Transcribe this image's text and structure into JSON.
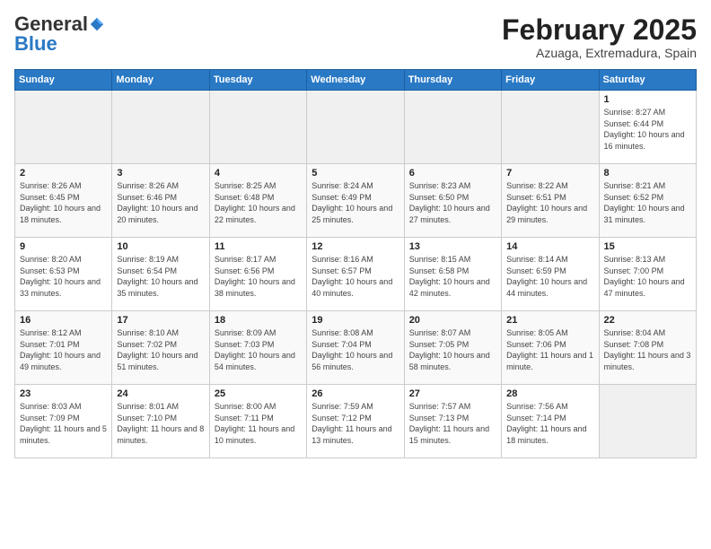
{
  "logo": {
    "general": "General",
    "blue": "Blue"
  },
  "title": {
    "month": "February 2025",
    "location": "Azuaga, Extremadura, Spain"
  },
  "headers": [
    "Sunday",
    "Monday",
    "Tuesday",
    "Wednesday",
    "Thursday",
    "Friday",
    "Saturday"
  ],
  "weeks": [
    [
      {
        "day": "",
        "info": ""
      },
      {
        "day": "",
        "info": ""
      },
      {
        "day": "",
        "info": ""
      },
      {
        "day": "",
        "info": ""
      },
      {
        "day": "",
        "info": ""
      },
      {
        "day": "",
        "info": ""
      },
      {
        "day": "1",
        "info": "Sunrise: 8:27 AM\nSunset: 6:44 PM\nDaylight: 10 hours and 16 minutes."
      }
    ],
    [
      {
        "day": "2",
        "info": "Sunrise: 8:26 AM\nSunset: 6:45 PM\nDaylight: 10 hours and 18 minutes."
      },
      {
        "day": "3",
        "info": "Sunrise: 8:26 AM\nSunset: 6:46 PM\nDaylight: 10 hours and 20 minutes."
      },
      {
        "day": "4",
        "info": "Sunrise: 8:25 AM\nSunset: 6:48 PM\nDaylight: 10 hours and 22 minutes."
      },
      {
        "day": "5",
        "info": "Sunrise: 8:24 AM\nSunset: 6:49 PM\nDaylight: 10 hours and 25 minutes."
      },
      {
        "day": "6",
        "info": "Sunrise: 8:23 AM\nSunset: 6:50 PM\nDaylight: 10 hours and 27 minutes."
      },
      {
        "day": "7",
        "info": "Sunrise: 8:22 AM\nSunset: 6:51 PM\nDaylight: 10 hours and 29 minutes."
      },
      {
        "day": "8",
        "info": "Sunrise: 8:21 AM\nSunset: 6:52 PM\nDaylight: 10 hours and 31 minutes."
      }
    ],
    [
      {
        "day": "9",
        "info": "Sunrise: 8:20 AM\nSunset: 6:53 PM\nDaylight: 10 hours and 33 minutes."
      },
      {
        "day": "10",
        "info": "Sunrise: 8:19 AM\nSunset: 6:54 PM\nDaylight: 10 hours and 35 minutes."
      },
      {
        "day": "11",
        "info": "Sunrise: 8:17 AM\nSunset: 6:56 PM\nDaylight: 10 hours and 38 minutes."
      },
      {
        "day": "12",
        "info": "Sunrise: 8:16 AM\nSunset: 6:57 PM\nDaylight: 10 hours and 40 minutes."
      },
      {
        "day": "13",
        "info": "Sunrise: 8:15 AM\nSunset: 6:58 PM\nDaylight: 10 hours and 42 minutes."
      },
      {
        "day": "14",
        "info": "Sunrise: 8:14 AM\nSunset: 6:59 PM\nDaylight: 10 hours and 44 minutes."
      },
      {
        "day": "15",
        "info": "Sunrise: 8:13 AM\nSunset: 7:00 PM\nDaylight: 10 hours and 47 minutes."
      }
    ],
    [
      {
        "day": "16",
        "info": "Sunrise: 8:12 AM\nSunset: 7:01 PM\nDaylight: 10 hours and 49 minutes."
      },
      {
        "day": "17",
        "info": "Sunrise: 8:10 AM\nSunset: 7:02 PM\nDaylight: 10 hours and 51 minutes."
      },
      {
        "day": "18",
        "info": "Sunrise: 8:09 AM\nSunset: 7:03 PM\nDaylight: 10 hours and 54 minutes."
      },
      {
        "day": "19",
        "info": "Sunrise: 8:08 AM\nSunset: 7:04 PM\nDaylight: 10 hours and 56 minutes."
      },
      {
        "day": "20",
        "info": "Sunrise: 8:07 AM\nSunset: 7:05 PM\nDaylight: 10 hours and 58 minutes."
      },
      {
        "day": "21",
        "info": "Sunrise: 8:05 AM\nSunset: 7:06 PM\nDaylight: 11 hours and 1 minute."
      },
      {
        "day": "22",
        "info": "Sunrise: 8:04 AM\nSunset: 7:08 PM\nDaylight: 11 hours and 3 minutes."
      }
    ],
    [
      {
        "day": "23",
        "info": "Sunrise: 8:03 AM\nSunset: 7:09 PM\nDaylight: 11 hours and 5 minutes."
      },
      {
        "day": "24",
        "info": "Sunrise: 8:01 AM\nSunset: 7:10 PM\nDaylight: 11 hours and 8 minutes."
      },
      {
        "day": "25",
        "info": "Sunrise: 8:00 AM\nSunset: 7:11 PM\nDaylight: 11 hours and 10 minutes."
      },
      {
        "day": "26",
        "info": "Sunrise: 7:59 AM\nSunset: 7:12 PM\nDaylight: 11 hours and 13 minutes."
      },
      {
        "day": "27",
        "info": "Sunrise: 7:57 AM\nSunset: 7:13 PM\nDaylight: 11 hours and 15 minutes."
      },
      {
        "day": "28",
        "info": "Sunrise: 7:56 AM\nSunset: 7:14 PM\nDaylight: 11 hours and 18 minutes."
      },
      {
        "day": "",
        "info": ""
      }
    ]
  ]
}
